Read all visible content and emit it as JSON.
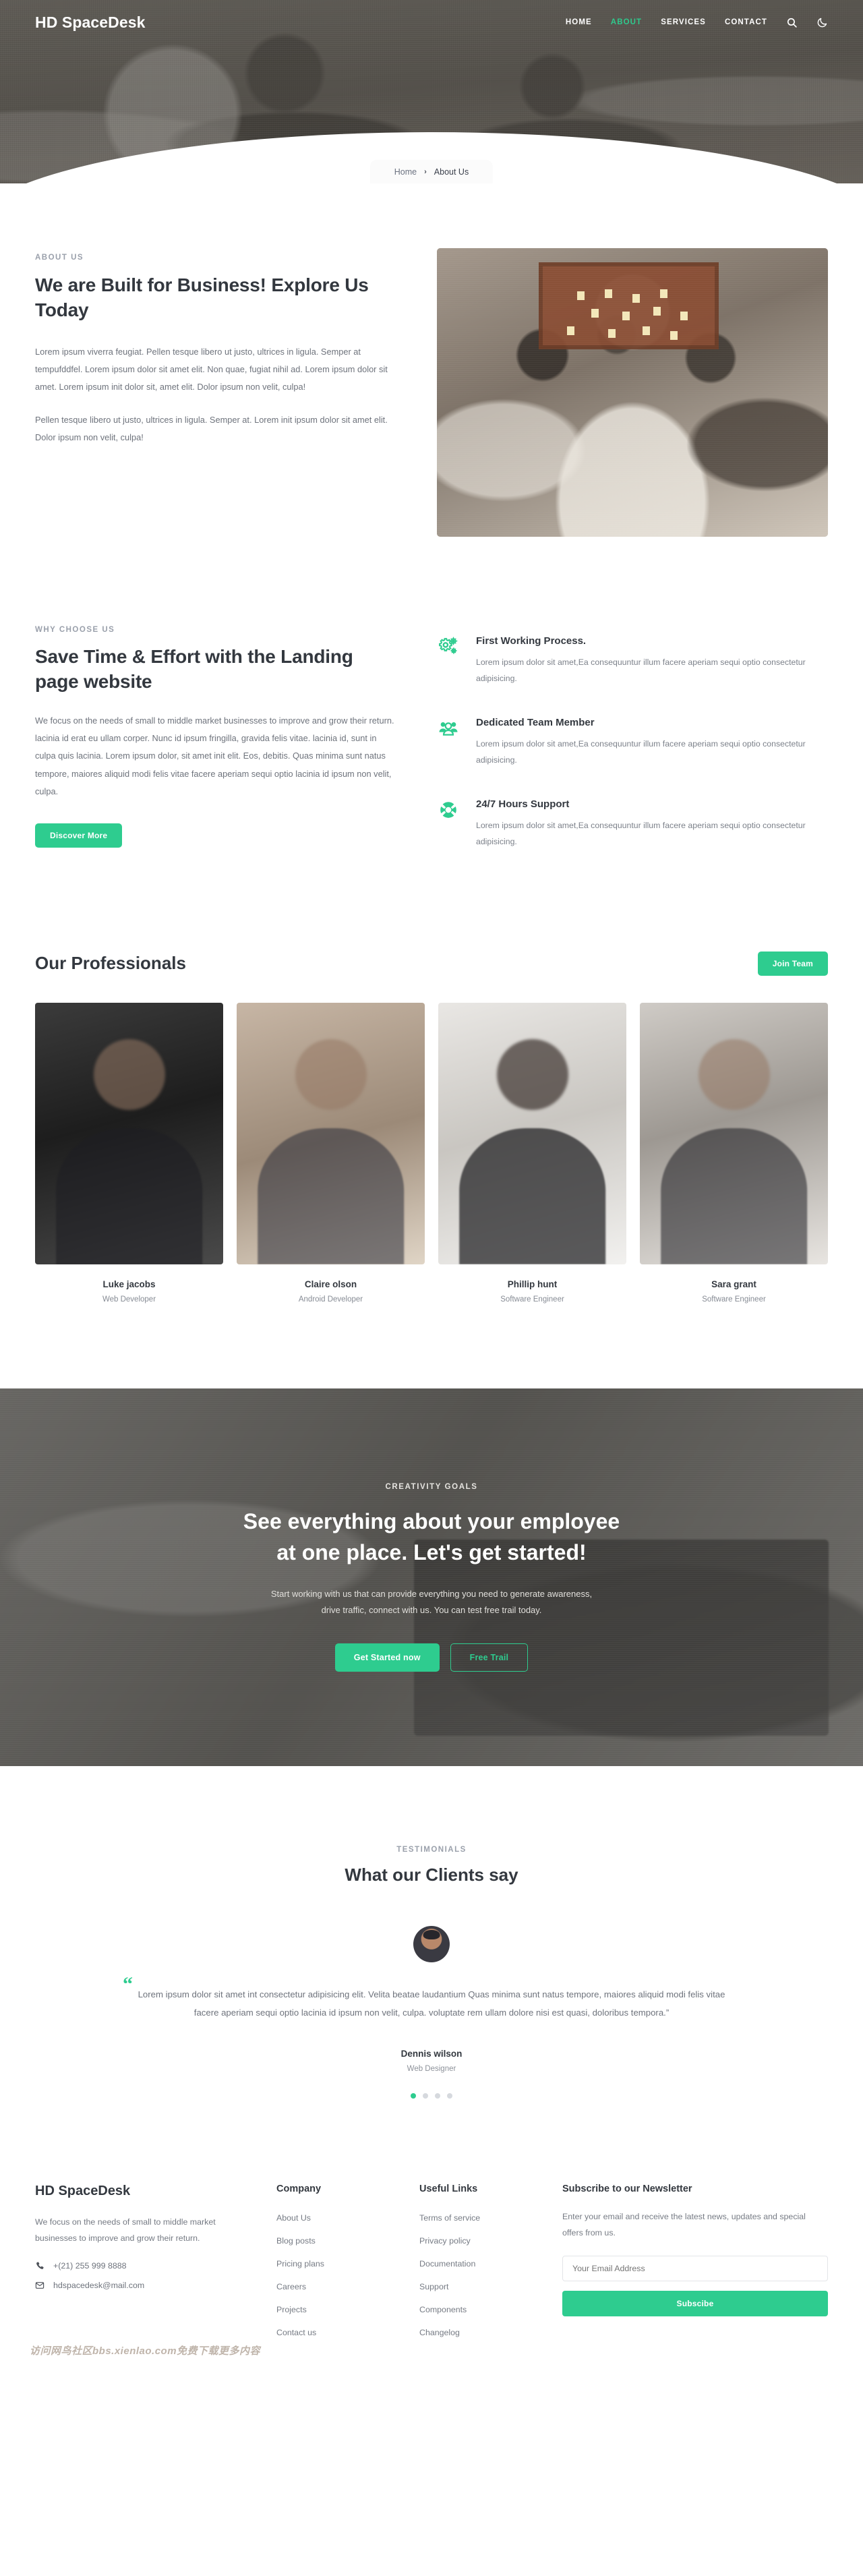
{
  "brand": "HD SpaceDesk",
  "nav": {
    "links": [
      {
        "label": "HOME",
        "active": false
      },
      {
        "label": "ABOUT",
        "active": true
      },
      {
        "label": "SERVICES",
        "active": false
      },
      {
        "label": "CONTACT",
        "active": false
      }
    ],
    "search_icon": "search-icon",
    "theme_icon": "moon-icon"
  },
  "breadcrumb": {
    "home": "Home",
    "separator": "›",
    "current": "About Us"
  },
  "about": {
    "eyebrow": "ABOUT US",
    "title": "We are Built for Business! Explore Us Today",
    "paragraph1": "Lorem ipsum viverra feugiat. Pellen tesque libero ut justo, ultrices in ligula. Semper at tempufddfel. Lorem ipsum dolor sit amet elit. Non quae, fugiat nihil ad. Lorem ipsum dolor sit amet. Lorem ipsum init dolor sit, amet elit. Dolor ipsum non velit, culpa!",
    "paragraph2": "Pellen tesque libero ut justo, ultrices in ligula. Semper at. Lorem init ipsum dolor sit amet elit. Dolor ipsum non velit, culpa!",
    "image_alt": "team-meeting-photo"
  },
  "why": {
    "eyebrow": "WHY CHOOSE US",
    "title": "Save Time & Effort with the Landing page website",
    "paragraph": "We focus on the needs of small to middle market businesses to improve and grow their return. lacinia id erat eu ullam corper. Nunc id ipsum fringilla, gravida felis vitae. lacinia id, sunt in culpa quis lacinia. Lorem ipsum dolor, sit amet init elit. Eos, debitis. Quas minima sunt natus tempore, maiores aliquid modi felis vitae facere aperiam sequi optio lacinia id ipsum non velit, culpa.",
    "button": "Discover More",
    "features": [
      {
        "icon": "gears-icon",
        "title": "First Working Process.",
        "text": "Lorem ipsum dolor sit amet,Ea consequuntur illum facere aperiam sequi optio consectetur adipisicing."
      },
      {
        "icon": "team-people-icon",
        "title": "Dedicated Team Member",
        "text": "Lorem ipsum dolor sit amet,Ea consequuntur illum facere aperiam sequi optio consectetur adipisicing."
      },
      {
        "icon": "lifebuoy-support-icon",
        "title": "24/7 Hours Support",
        "text": "Lorem ipsum dolor sit amet,Ea consequuntur illum facere aperiam sequi optio consectetur adipisicing."
      }
    ]
  },
  "team": {
    "title": "Our Professionals",
    "join_button": "Join Team",
    "members": [
      {
        "name": "Luke jacobs",
        "role": "Web Developer"
      },
      {
        "name": "Claire olson",
        "role": "Android Developer"
      },
      {
        "name": "Phillip hunt",
        "role": "Software Engineer"
      },
      {
        "name": "Sara grant",
        "role": "Software Engineer"
      }
    ]
  },
  "cta": {
    "eyebrow": "CREATIVITY GOALS",
    "title_line1": "See everything about your employee",
    "title_line2": "at one place. Let's get started!",
    "subtitle_line1": "Start working with us that can provide everything you need to generate awareness,",
    "subtitle_line2": "drive traffic, connect with us. You can test free trail today.",
    "primary_button": "Get Started now",
    "secondary_button": "Free Trail"
  },
  "testimonials": {
    "eyebrow": "TESTIMONIALS",
    "title": "What our Clients say",
    "quote_mark": "“",
    "quote": "Lorem ipsum dolor sit amet int consectetur adipisicing elit. Velita beatae laudantium Quas minima sunt natus tempore, maiores aliquid modi felis vitae facere aperiam sequi optio lacinia id ipsum non velit, culpa. voluptate rem ullam dolore nisi est quasi, doloribus tempora.”",
    "author": "Dennis wilson",
    "author_role": "Web Designer",
    "dots": 4,
    "active_dot": 0
  },
  "footer": {
    "brand": "HD SpaceDesk",
    "description": "We focus on the needs of small to middle market businesses to improve and grow their return.",
    "phone": "+(21) 255 999 8888",
    "phone_icon": "phone-icon",
    "email": "hdspacedesk@mail.com",
    "email_icon": "envelope-icon",
    "company": {
      "heading": "Company",
      "links": [
        "About Us",
        "Blog posts",
        "Pricing plans",
        "Careers",
        "Projects",
        "Contact us"
      ]
    },
    "useful": {
      "heading": "Useful Links",
      "links": [
        "Terms of service",
        "Privacy policy",
        "Documentation",
        "Support",
        "Components",
        "Changelog"
      ]
    },
    "newsletter": {
      "heading": "Subscribe to our Newsletter",
      "text": "Enter your email and receive the latest news, updates and special offers from us.",
      "placeholder": "Your Email Address",
      "value": "",
      "button": "Subscibe"
    }
  },
  "watermark": "访问网鸟社区bbs.xienlao.com免费下载更多内容",
  "colors": {
    "accent": "#2ecc8f",
    "heading": "#33383f",
    "body": "#6e737c",
    "muted": "#9aa0ab"
  }
}
